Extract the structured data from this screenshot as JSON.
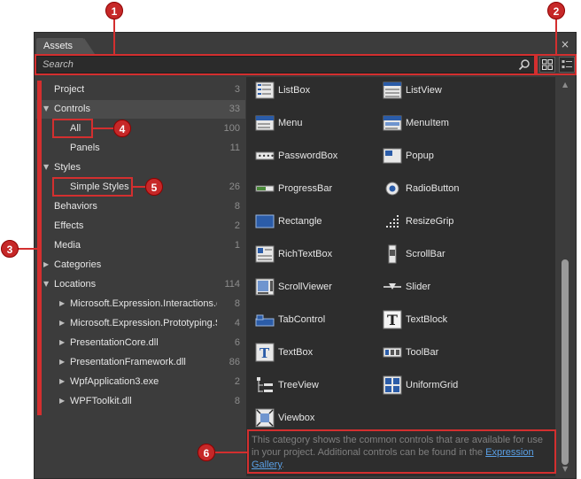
{
  "panel": {
    "tab_label": "Assets",
    "close_glyph": "×"
  },
  "search": {
    "placeholder": "Search"
  },
  "tree": [
    {
      "label": "Project",
      "count": "3",
      "arrow": "",
      "indent": 0
    },
    {
      "label": "Controls",
      "count": "33",
      "arrow": "▼",
      "indent": 0
    },
    {
      "label": "All",
      "count": "100",
      "arrow": "",
      "indent": 1
    },
    {
      "label": "Panels",
      "count": "11",
      "arrow": "",
      "indent": 1
    },
    {
      "label": "Styles",
      "count": "",
      "arrow": "▼",
      "indent": 0
    },
    {
      "label": "Simple Styles",
      "count": "26",
      "arrow": "",
      "indent": 1
    },
    {
      "label": "Behaviors",
      "count": "8",
      "arrow": "",
      "indent": 0
    },
    {
      "label": "Effects",
      "count": "2",
      "arrow": "",
      "indent": 0
    },
    {
      "label": "Media",
      "count": "1",
      "arrow": "",
      "indent": 0
    },
    {
      "label": "Categories",
      "count": "",
      "arrow": "▶",
      "indent": 0
    },
    {
      "label": "Locations",
      "count": "114",
      "arrow": "▼",
      "indent": 0
    },
    {
      "label": "Microsoft.Expression.Interactions.dll",
      "count": "8",
      "arrow": "▶",
      "indent": 1
    },
    {
      "label": "Microsoft.Expression.Prototyping.Sket...",
      "count": "4",
      "arrow": "▶",
      "indent": 1
    },
    {
      "label": "PresentationCore.dll",
      "count": "6",
      "arrow": "▶",
      "indent": 1
    },
    {
      "label": "PresentationFramework.dll",
      "count": "86",
      "arrow": "▶",
      "indent": 1
    },
    {
      "label": "WpfApplication3.exe",
      "count": "2",
      "arrow": "▶",
      "indent": 1
    },
    {
      "label": "WPFToolkit.dll",
      "count": "8",
      "arrow": "▶",
      "indent": 1
    }
  ],
  "assets": [
    {
      "label": "ListBox",
      "icon": "listbox-icon"
    },
    {
      "label": "ListView",
      "icon": "listview-icon"
    },
    {
      "label": "Menu",
      "icon": "menu-icon"
    },
    {
      "label": "MenuItem",
      "icon": "menuitem-icon"
    },
    {
      "label": "PasswordBox",
      "icon": "passwordbox-icon"
    },
    {
      "label": "Popup",
      "icon": "popup-icon"
    },
    {
      "label": "ProgressBar",
      "icon": "progressbar-icon"
    },
    {
      "label": "RadioButton",
      "icon": "radiobutton-icon"
    },
    {
      "label": "Rectangle",
      "icon": "rectangle-icon"
    },
    {
      "label": "ResizeGrip",
      "icon": "resizegrip-icon"
    },
    {
      "label": "RichTextBox",
      "icon": "richtextbox-icon"
    },
    {
      "label": "ScrollBar",
      "icon": "scrollbar-icon"
    },
    {
      "label": "ScrollViewer",
      "icon": "scrollviewer-icon"
    },
    {
      "label": "Slider",
      "icon": "slider-icon"
    },
    {
      "label": "TabControl",
      "icon": "tabcontrol-icon"
    },
    {
      "label": "TextBlock",
      "icon": "textblock-icon"
    },
    {
      "label": "TextBox",
      "icon": "textbox-icon"
    },
    {
      "label": "ToolBar",
      "icon": "toolbar-icon"
    },
    {
      "label": "TreeView",
      "icon": "treeview-icon"
    },
    {
      "label": "UniformGrid",
      "icon": "uniformgrid-icon"
    },
    {
      "label": "Viewbox",
      "icon": "viewbox-icon"
    }
  ],
  "description": {
    "text": "This category shows the common controls that are available for use in your project. Additional controls can be found in the ",
    "link": "Expression Gallery",
    "suffix": "."
  },
  "callouts": [
    "1",
    "2",
    "3",
    "4",
    "5",
    "6"
  ],
  "colors": {
    "accent": "#d32f2f",
    "link": "#5aa0e6",
    "panel_bg": "#3c3c3c",
    "grid_bg": "#2d2d2d"
  }
}
